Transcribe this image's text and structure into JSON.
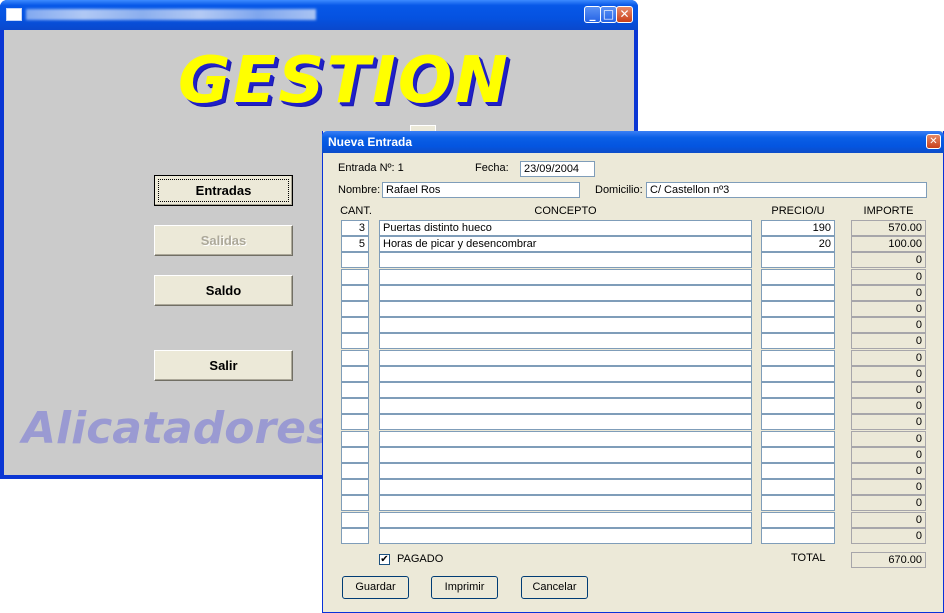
{
  "main_window": {
    "logo": "GESTION",
    "watermark": "Alicatadores",
    "buttons": {
      "entradas": "Entradas",
      "salidas": "Salidas",
      "saldo": "Saldo",
      "salir": "Salir"
    }
  },
  "dialog": {
    "title": "Nueva Entrada",
    "entrada_label": "Entrada Nº: 1",
    "fecha_label": "Fecha:",
    "fecha_value": "23/09/2004",
    "nombre_label": "Nombre:",
    "nombre_value": "Rafael Ros",
    "domicilio_label": "Domicilio:",
    "domicilio_value": "C/ Castellon nº3",
    "columns": {
      "cant": "CANT.",
      "concepto": "CONCEPTO",
      "precio": "PRECIO/U",
      "importe": "IMPORTE"
    },
    "rows": [
      {
        "cant": "3",
        "concepto": "Puertas distinto hueco",
        "precio": "190",
        "importe": "570.00"
      },
      {
        "cant": "5",
        "concepto": "Horas de picar y desencombrar",
        "precio": "20",
        "importe": "100.00"
      },
      {
        "cant": "",
        "concepto": "",
        "precio": "",
        "importe": "0"
      },
      {
        "cant": "",
        "concepto": "",
        "precio": "",
        "importe": "0"
      },
      {
        "cant": "",
        "concepto": "",
        "precio": "",
        "importe": "0"
      },
      {
        "cant": "",
        "concepto": "",
        "precio": "",
        "importe": "0"
      },
      {
        "cant": "",
        "concepto": "",
        "precio": "",
        "importe": "0"
      },
      {
        "cant": "",
        "concepto": "",
        "precio": "",
        "importe": "0"
      },
      {
        "cant": "",
        "concepto": "",
        "precio": "",
        "importe": "0"
      },
      {
        "cant": "",
        "concepto": "",
        "precio": "",
        "importe": "0"
      },
      {
        "cant": "",
        "concepto": "",
        "precio": "",
        "importe": "0"
      },
      {
        "cant": "",
        "concepto": "",
        "precio": "",
        "importe": "0"
      },
      {
        "cant": "",
        "concepto": "",
        "precio": "",
        "importe": "0"
      },
      {
        "cant": "",
        "concepto": "",
        "precio": "",
        "importe": "0"
      },
      {
        "cant": "",
        "concepto": "",
        "precio": "",
        "importe": "0"
      },
      {
        "cant": "",
        "concepto": "",
        "precio": "",
        "importe": "0"
      },
      {
        "cant": "",
        "concepto": "",
        "precio": "",
        "importe": "0"
      },
      {
        "cant": "",
        "concepto": "",
        "precio": "",
        "importe": "0"
      },
      {
        "cant": "",
        "concepto": "",
        "precio": "",
        "importe": "0"
      },
      {
        "cant": "",
        "concepto": "",
        "precio": "",
        "importe": "0"
      }
    ],
    "pagado_label": "PAGADO",
    "pagado_checked": true,
    "check_mark": "✔",
    "total_label": "TOTAL",
    "total_value": "670.00",
    "buttons": {
      "guardar": "Guardar",
      "imprimir": "Imprimir",
      "cancelar": "Cancelar"
    },
    "close_glyph": "✕"
  },
  "icons": {
    "minimize": "minimize-icon",
    "maximize": "maximize-icon",
    "close": "close-icon"
  }
}
